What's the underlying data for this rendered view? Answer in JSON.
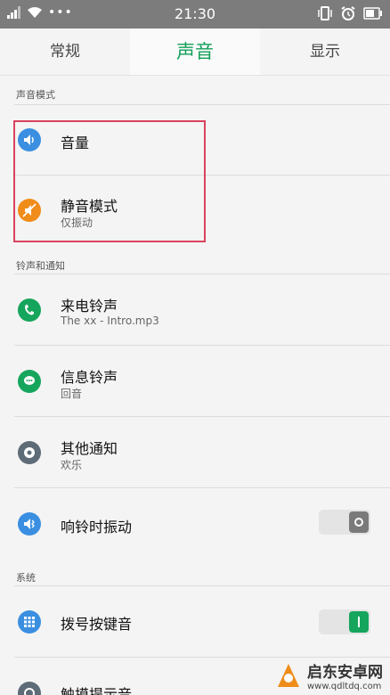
{
  "status_bar": {
    "time": "21:30"
  },
  "tabs": [
    {
      "label": "常规",
      "active": false
    },
    {
      "label": "声音",
      "active": true
    },
    {
      "label": "显示",
      "active": false
    }
  ],
  "sections": {
    "sound_mode": "声音模式",
    "ringtones": "铃声和通知",
    "system": "系统"
  },
  "rows": {
    "volume": {
      "title": "音量"
    },
    "silent": {
      "title": "静音模式",
      "subtitle": "仅振动"
    },
    "incoming_call": {
      "title": "来电铃声",
      "subtitle": "The xx - Intro.mp3"
    },
    "message": {
      "title": "信息铃声",
      "subtitle": "回音"
    },
    "other_notify": {
      "title": "其他通知",
      "subtitle": "欢乐"
    },
    "vibrate_ring": {
      "title": "响铃时振动",
      "toggle": false
    },
    "dial_keytone": {
      "title": "拨号按键音",
      "toggle": true
    },
    "touch_tone": {
      "title": "触摸提示音"
    }
  },
  "colors": {
    "accent": "#12a05a",
    "highlight_box": "#d9435e",
    "blue_icon": "#3b8fe0",
    "orange_icon": "#f08c1a",
    "green_icon": "#16a55c",
    "gray_icon": "#5e6c78"
  },
  "watermark": {
    "name": "启东安卓网",
    "url": "www.qdltdq.com"
  }
}
